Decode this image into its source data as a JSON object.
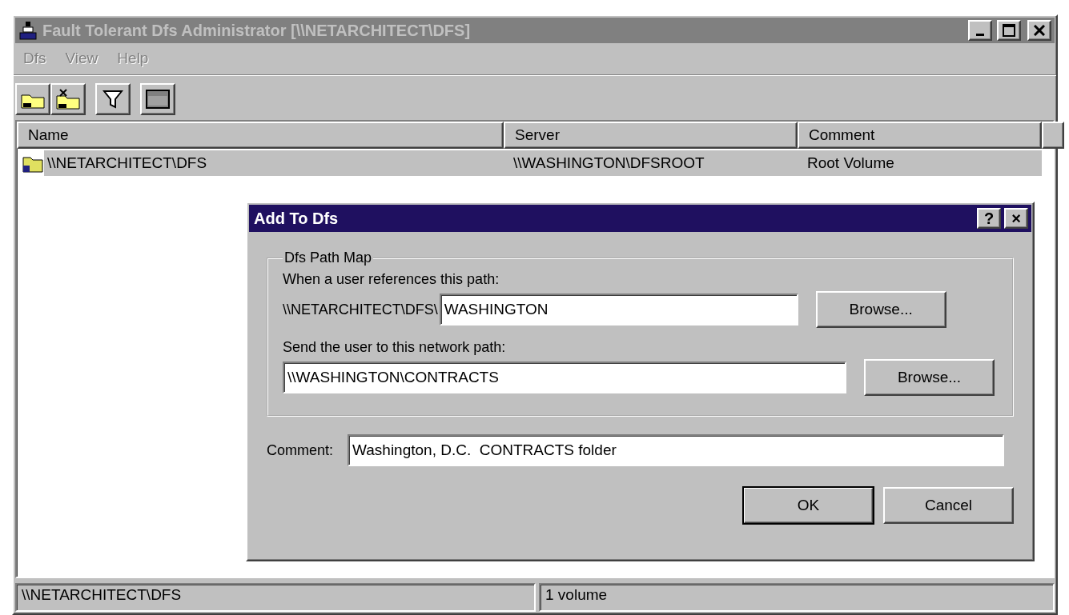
{
  "window": {
    "title": "Fault Tolerant Dfs Administrator [\\\\NETARCHITECT\\DFS]",
    "active": false
  },
  "menu": [
    {
      "label": "Dfs",
      "disabled": true
    },
    {
      "label": "View",
      "disabled": true
    },
    {
      "label": "Help",
      "disabled": true
    }
  ],
  "toolbar": [
    {
      "kind": "add"
    },
    {
      "kind": "remove"
    },
    {
      "kind": "filter"
    },
    {
      "kind": "window"
    }
  ],
  "table": {
    "columns": [
      "Name",
      "Server",
      "Comment"
    ],
    "rows": [
      {
        "name": "\\\\NETARCHITECT\\DFS",
        "server": "\\\\WASHINGTON\\DFSROOT",
        "comment": "Root Volume",
        "selected": true
      }
    ]
  },
  "dialog": {
    "title": "Add To Dfs",
    "help": "?",
    "close": "×",
    "group": {
      "label": "Dfs Path Map",
      "path_label": "When a user references this path:",
      "path_prefix": "\\\\NETARCHITECT\\DFS\\",
      "path_value": "WASHINGTON",
      "browse_1": "Browse...",
      "network_label": "Send the user to this network path:",
      "network_value": "\\\\WASHINGTON\\CONTRACTS",
      "browse_2": "Browse..."
    },
    "comment_label": "Comment:",
    "comment_value": "Washington, D.C.  CONTRACTS folder",
    "buttons": [
      {
        "label": "OK",
        "default": true
      },
      {
        "label": "Cancel",
        "default": false
      }
    ]
  },
  "status_bar": [
    "\\\\NETARCHITECT\\DFS",
    "1 volume"
  ]
}
